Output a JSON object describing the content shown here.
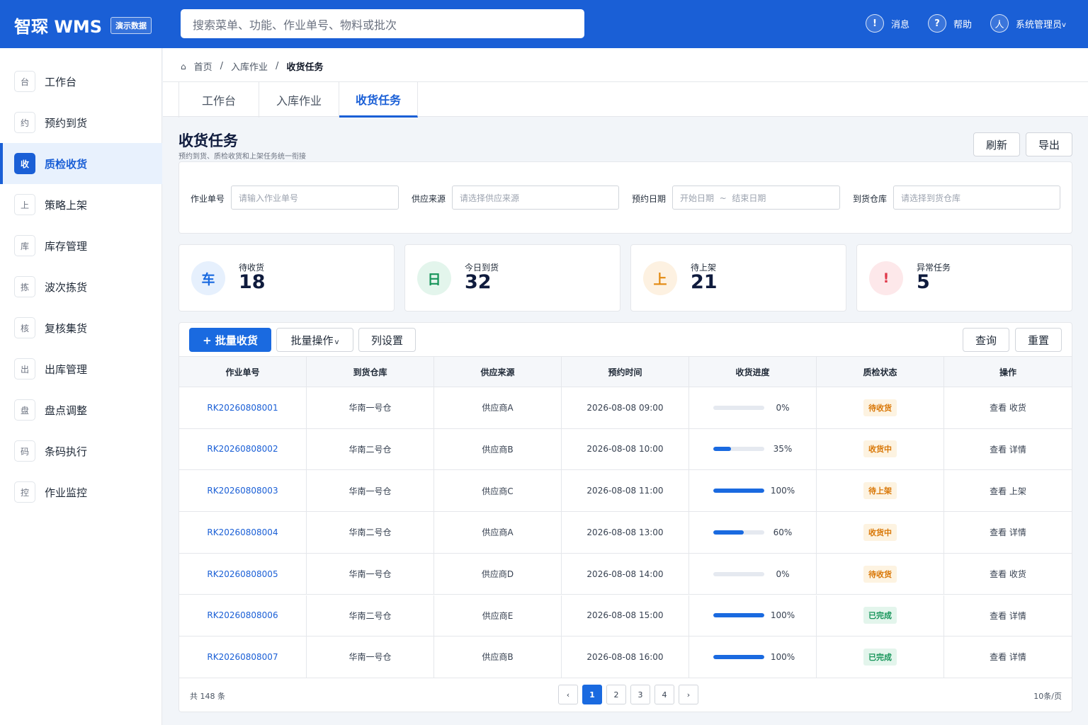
{
  "header": {
    "logo": "智琛 WMS",
    "demo_badge": "演示数据",
    "search_placeholder": "搜索菜单、功能、作业单号、物料或批次",
    "messages": {
      "icon": "!",
      "label": "消息"
    },
    "help": {
      "icon": "?",
      "label": "帮助"
    },
    "user": {
      "icon": "人",
      "label": "系统管理员",
      "caret": "v"
    }
  },
  "sidebar": {
    "items": [
      {
        "icon": "台",
        "label": "工作台"
      },
      {
        "icon": "约",
        "label": "预约到货"
      },
      {
        "icon": "收",
        "label": "质检收货",
        "active": true
      },
      {
        "icon": "上",
        "label": "策略上架"
      },
      {
        "icon": "库",
        "label": "库存管理"
      },
      {
        "icon": "拣",
        "label": "波次拣货"
      },
      {
        "icon": "核",
        "label": "复核集货"
      },
      {
        "icon": "出",
        "label": "出库管理"
      },
      {
        "icon": "盘",
        "label": "盘点调整"
      },
      {
        "icon": "码",
        "label": "条码执行"
      },
      {
        "icon": "控",
        "label": "作业监控"
      }
    ]
  },
  "breadcrumb": {
    "home_icon": "⌂",
    "items": [
      "首页",
      "入库作业",
      "收货任务"
    ],
    "separator": "/"
  },
  "tabs": [
    {
      "label": "工作台"
    },
    {
      "label": "入库作业"
    },
    {
      "label": "收货任务",
      "active": true
    }
  ],
  "page": {
    "title": "收货任务",
    "subtitle": "预约到货、质检收货和上架任务统一衔接",
    "refresh_label": "刷新",
    "export_label": "导出"
  },
  "filters": [
    {
      "label": "作业单号",
      "placeholder": "请输入作业单号"
    },
    {
      "label": "供应来源",
      "placeholder": "请选择供应来源"
    },
    {
      "label": "预约日期",
      "placeholder": "开始日期  ~  结束日期"
    },
    {
      "label": "到货仓库",
      "placeholder": "请选择到货仓库"
    }
  ],
  "stats": [
    {
      "icon": "车",
      "label": "待收货",
      "value": "18",
      "color": "#1a6ae0",
      "bg": "#e6f0fd"
    },
    {
      "icon": "日",
      "label": "今日到货",
      "value": "32",
      "color": "#17955a",
      "bg": "#e3f5ec"
    },
    {
      "icon": "上",
      "label": "待上架",
      "value": "21",
      "color": "#e38a12",
      "bg": "#fdf1e1"
    },
    {
      "icon": "!",
      "label": "异常任务",
      "value": "5",
      "color": "#e0384a",
      "bg": "#fde8ea"
    }
  ],
  "toolbar": {
    "batch_receive": "+ 批量收货",
    "batch_ops": "批量操作",
    "batch_ops_caret": "v",
    "columns": "列设置",
    "query": "查询",
    "reset": "重置"
  },
  "table": {
    "columns": [
      "作业单号",
      "到货仓库",
      "供应来源",
      "预约时间",
      "收货进度",
      "质检状态",
      "操作"
    ],
    "rows": [
      {
        "id": "RK20260808001",
        "warehouse": "华南一号仓",
        "supplier": "供应商A",
        "time": "2026-08-08 09:00",
        "progress": 0,
        "progress_text": "0%",
        "status": "待收货",
        "status_type": "pending",
        "actions": "查看 收货"
      },
      {
        "id": "RK20260808002",
        "warehouse": "华南二号仓",
        "supplier": "供应商B",
        "time": "2026-08-08 10:00",
        "progress": 35,
        "progress_text": "35%",
        "status": "收货中",
        "status_type": "pending",
        "actions": "查看 详情"
      },
      {
        "id": "RK20260808003",
        "warehouse": "华南一号仓",
        "supplier": "供应商C",
        "time": "2026-08-08 11:00",
        "progress": 100,
        "progress_text": "100%",
        "status": "待上架",
        "status_type": "pending",
        "actions": "查看 上架"
      },
      {
        "id": "RK20260808004",
        "warehouse": "华南二号仓",
        "supplier": "供应商A",
        "time": "2026-08-08 13:00",
        "progress": 60,
        "progress_text": "60%",
        "status": "收货中",
        "status_type": "pending",
        "actions": "查看 详情"
      },
      {
        "id": "RK20260808005",
        "warehouse": "华南一号仓",
        "supplier": "供应商D",
        "time": "2026-08-08 14:00",
        "progress": 0,
        "progress_text": "0%",
        "status": "待收货",
        "status_type": "pending",
        "actions": "查看 收货"
      },
      {
        "id": "RK20260808006",
        "warehouse": "华南二号仓",
        "supplier": "供应商E",
        "time": "2026-08-08 15:00",
        "progress": 100,
        "progress_text": "100%",
        "status": "已完成",
        "status_type": "done",
        "actions": "查看 详情"
      },
      {
        "id": "RK20260808007",
        "warehouse": "华南一号仓",
        "supplier": "供应商B",
        "time": "2026-08-08 16:00",
        "progress": 100,
        "progress_text": "100%",
        "status": "已完成",
        "status_type": "done",
        "actions": "查看 详情"
      }
    ]
  },
  "status_colors": {
    "pending": {
      "fg": "#d97706",
      "bg": "#fdf3e1"
    },
    "done": {
      "fg": "#17955a",
      "bg": "#e3f5ec"
    }
  },
  "pagination": {
    "total": "共 148 条",
    "prev": "‹",
    "next": "›",
    "pages": [
      "1",
      "2",
      "3",
      "4"
    ],
    "current": "1",
    "page_size": "10条/页"
  }
}
